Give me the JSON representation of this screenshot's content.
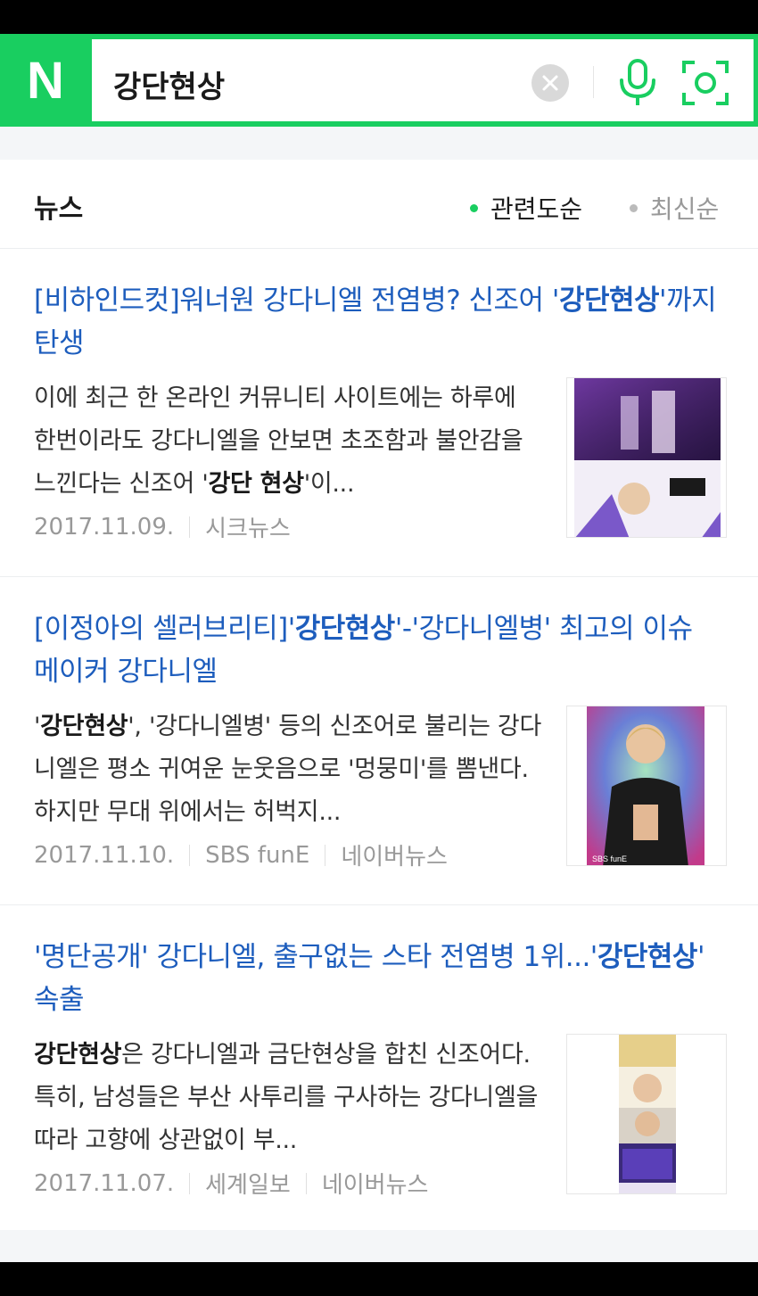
{
  "search": {
    "logo": "N",
    "query": "강단현상"
  },
  "section": {
    "title": "뉴스",
    "sort_options": [
      "관련도순",
      "최신순"
    ],
    "active_sort": "관련도순"
  },
  "articles": [
    {
      "title_parts": [
        "[비하인드컷]워너원 강다니엘 전염병? 신조어 '",
        "강단현상",
        "'까지 탄생"
      ],
      "snippet_parts": [
        "이에 최근 한 온라인 커뮤니티 사이트에는 하루에 한번이라도 강다니엘을 안보면 초조함과 불안감을 느낀다는 신조어 '",
        "강단 현상",
        "'이..."
      ],
      "date": "2017.11.09.",
      "source": "시크뉴스"
    },
    {
      "title_parts": [
        "[이정아의 셀러브리티]'",
        "강단현상",
        "'-'강다니엘병' 최고의 이슈 메이커 강다니엘"
      ],
      "snippet_parts": [
        "'",
        "강단현상",
        "', '강다니엘병' 등의 신조어로 불리는 강다니엘은 평소 귀여운 눈웃음으로 '멍뭉미'를 뽐낸다. 하지만 무대 위에서는 허벅지..."
      ],
      "date": "2017.11.10.",
      "source": "SBS funE",
      "aggregator": "네이버뉴스",
      "thumb_text": "SBS funE"
    },
    {
      "title_parts": [
        "'명단공개' 강다니엘, 출구없는 스타 전염병 1위...'",
        "강단현상",
        "' 속출"
      ],
      "snippet_parts": [
        "",
        "강단현상",
        "은 강다니엘과 금단현상을 합친 신조어다. 특히, 남성들은 부산 사투리를 구사하는 강다니엘을 따라 고향에 상관없이 부..."
      ],
      "date": "2017.11.07.",
      "source": "세계일보",
      "aggregator": "네이버뉴스"
    }
  ],
  "colors": {
    "brand": "#19ce60",
    "link": "#1d5dbd",
    "meta": "#999999"
  },
  "icons": [
    "clear-icon",
    "mic-icon",
    "lens-icon"
  ]
}
